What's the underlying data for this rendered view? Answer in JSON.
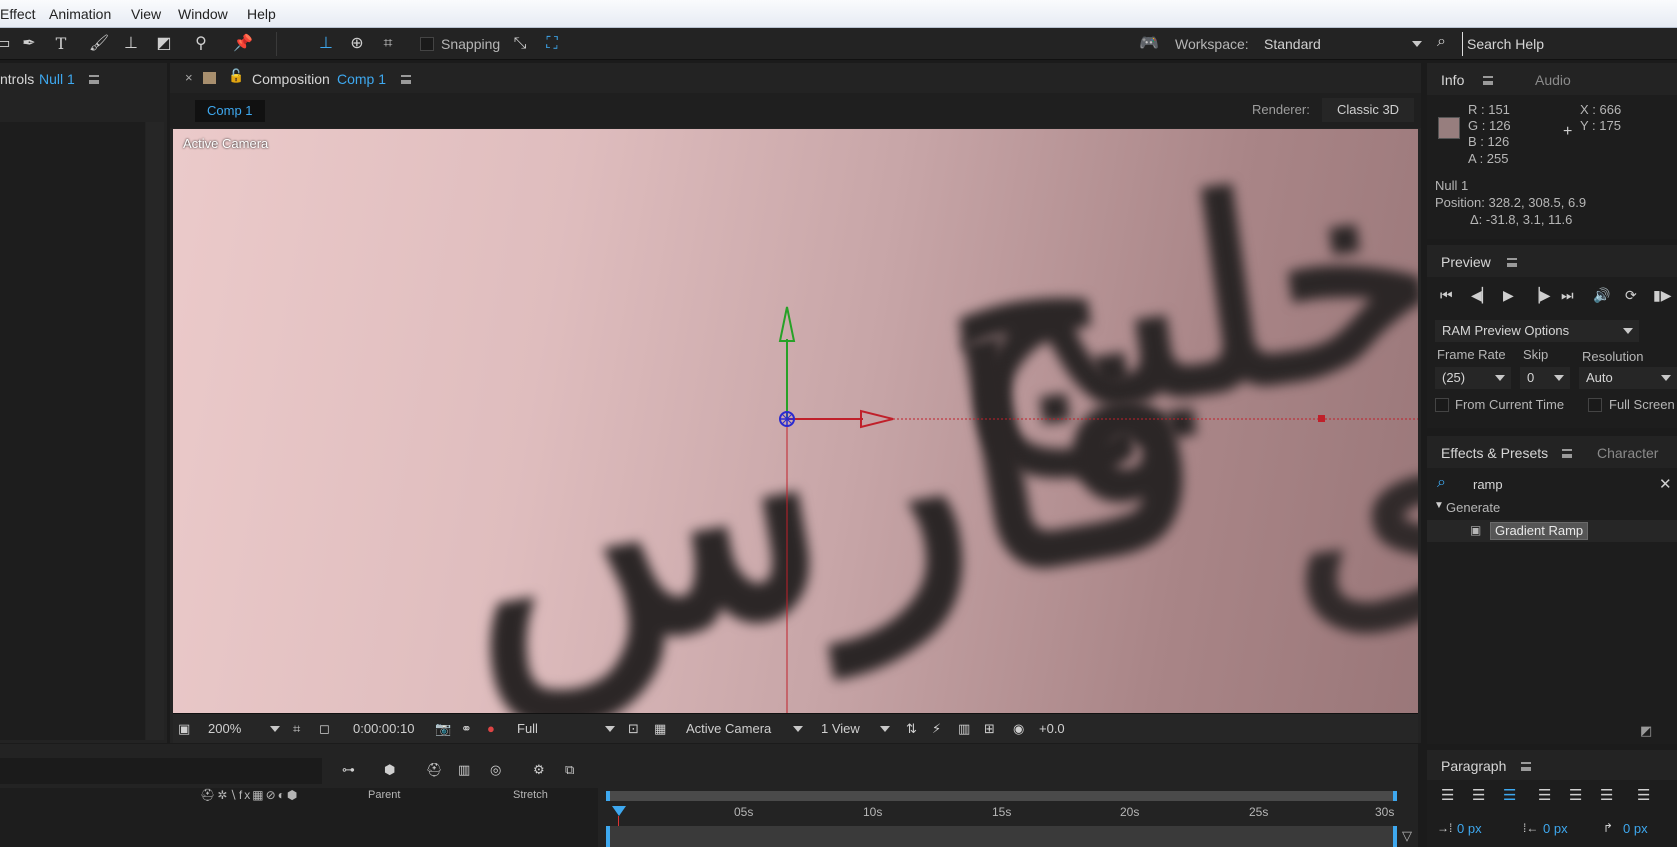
{
  "menu": [
    "Effect",
    "Animation",
    "View",
    "Window",
    "Help"
  ],
  "toolbar": {
    "snapping_label": "Snapping",
    "workspace_label": "Workspace:",
    "workspace_value": "Standard",
    "search_placeholder": "Search Help"
  },
  "effect_controls": {
    "tab_label": "ntrols",
    "layer": "Null 1"
  },
  "composition": {
    "tab_label": "Composition",
    "comp_name": "Comp 1",
    "crumb": "Comp 1",
    "renderer_label": "Renderer:",
    "renderer_value": "Classic 3D",
    "camera_label": "Active Camera",
    "artwork_text_1": "خلیج",
    "artwork_text_2": "فارس"
  },
  "viewer_bar": {
    "zoom": "200%",
    "timecode": "0:00:00:10",
    "resolution": "Full",
    "camera": "Active Camera",
    "views": "1 View",
    "exposure": "+0.0"
  },
  "info": {
    "tab_info": "Info",
    "tab_audio": "Audio",
    "r": "R : 151",
    "g": "G : 126",
    "b": "B : 126",
    "a": "A :  255",
    "x": "X : 666",
    "y": "Y : 175",
    "swatch_color": "#977e7e",
    "layer": "Null 1",
    "position": "Position: 328.2, 308.5, 6.9",
    "delta": "Δ: -31.8, 3.1, 11.6"
  },
  "preview": {
    "tab": "Preview",
    "ram_options": "RAM Preview Options",
    "frame_rate_label": "Frame Rate",
    "skip_label": "Skip",
    "resolution_label": "Resolution",
    "frame_rate_value": "(25)",
    "skip_value": "0",
    "resolution_value": "Auto",
    "from_current": "From Current Time",
    "full_screen": "Full Screen"
  },
  "effects": {
    "tab": "Effects & Presets",
    "tab_character": "Character",
    "search_value": "ramp",
    "category": "Generate",
    "item": "Gradient Ramp"
  },
  "paragraph": {
    "tab": "Paragraph",
    "indent_left": "0 px",
    "indent_first": "0 px",
    "indent_right": "0 px"
  },
  "timeline": {
    "ruler": [
      "05s",
      "10s",
      "15s",
      "20s",
      "25s",
      "30s"
    ],
    "col_parent": "Parent",
    "col_stretch": "Stretch"
  },
  "colors": {
    "accent": "#3ea8ef",
    "x_axis": "#c0202a",
    "y_axis": "#27a127",
    "z_axis": "#2a2ad0"
  }
}
